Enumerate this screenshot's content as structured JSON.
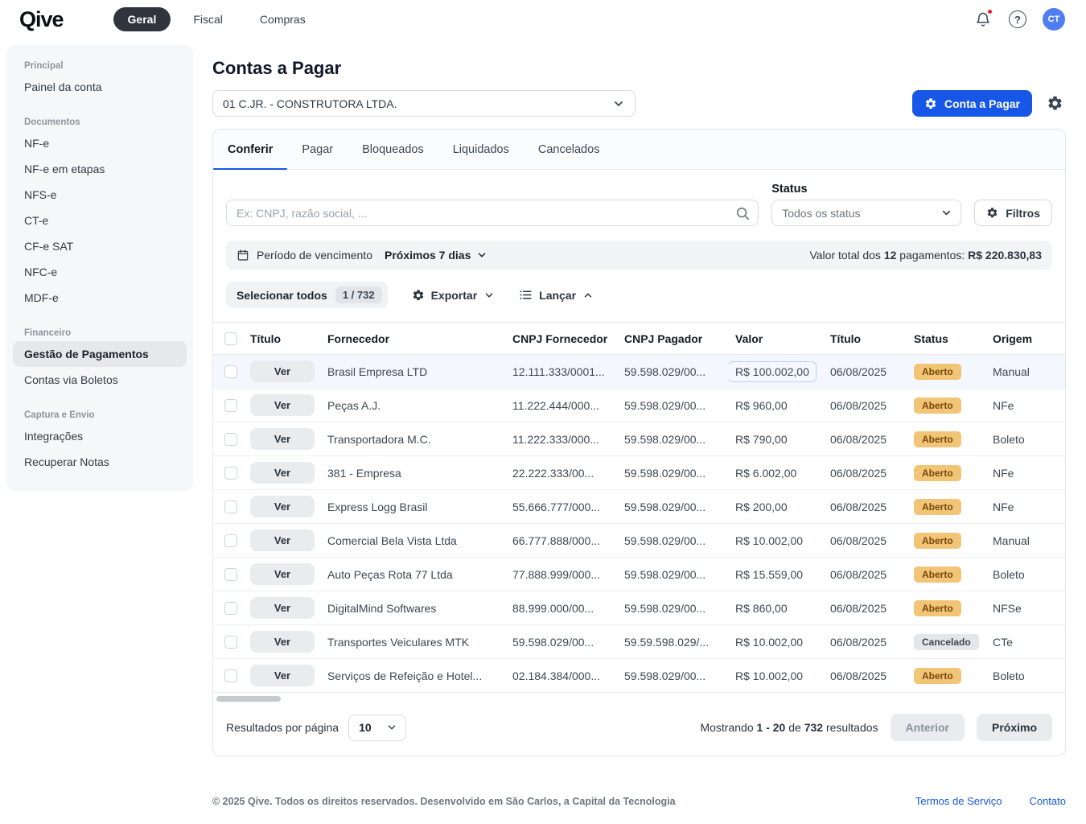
{
  "topbar": {
    "logo": "Qive",
    "nav": [
      {
        "label": "Geral",
        "active": true
      },
      {
        "label": "Fiscal",
        "active": false
      },
      {
        "label": "Compras",
        "active": false
      }
    ],
    "help_glyph": "?",
    "avatar": "CT"
  },
  "sidebar": {
    "sections": [
      {
        "title": "Principal",
        "items": [
          {
            "label": "Painel da conta",
            "active": false
          }
        ]
      },
      {
        "title": "Documentos",
        "items": [
          {
            "label": "NF-e",
            "active": false
          },
          {
            "label": "NF-e em etapas",
            "active": false
          },
          {
            "label": "NFS-e",
            "active": false
          },
          {
            "label": "CT-e",
            "active": false
          },
          {
            "label": "CF-e SAT",
            "active": false
          },
          {
            "label": "NFC-e",
            "active": false
          },
          {
            "label": "MDF-e",
            "active": false
          }
        ]
      },
      {
        "title": "Financeiro",
        "items": [
          {
            "label": "Gestão de Pagamentos",
            "active": true
          },
          {
            "label": "Contas via Boletos",
            "active": false
          }
        ]
      },
      {
        "title": "Captura e Envio",
        "items": [
          {
            "label": "Integrações",
            "active": false
          },
          {
            "label": "Recuperar Notas",
            "active": false
          }
        ]
      }
    ]
  },
  "page": {
    "title": "Contas a Pagar",
    "company_select": "01 C.JR. - CONSTRUTORA LTDA.",
    "primary_button": "Conta a Pagar"
  },
  "tabs": [
    {
      "label": "Conferir",
      "active": true
    },
    {
      "label": "Pagar",
      "active": false
    },
    {
      "label": "Bloqueados",
      "active": false
    },
    {
      "label": "Liquidados",
      "active": false
    },
    {
      "label": "Cancelados",
      "active": false
    }
  ],
  "filters": {
    "search_placeholder": "Ex: CNPJ, razão social, ...",
    "status_label": "Status",
    "status_value": "Todos os status",
    "filters_button": "Filtros",
    "period_label": "Período de vencimento",
    "period_value": "Próximos 7 dias",
    "total_prefix": "Valor total dos",
    "total_count": "12",
    "total_mid": "pagamentos:",
    "total_value": "R$ 220.830,83"
  },
  "actions": {
    "select_all_label": "Selecionar todos",
    "selected_badge": "1 / 732",
    "export_label": "Exportar",
    "launch_label": "Lançar"
  },
  "table": {
    "headers": [
      "Título",
      "Fornecedor",
      "CNPJ Fornecedor",
      "CNPJ Pagador",
      "Valor",
      "Título",
      "Status",
      "Origem"
    ],
    "view_label": "Ver",
    "rows": [
      {
        "fornecedor": "Brasil Empresa LTD",
        "cnpj_fornecedor": "12.111.333/0001...",
        "cnpj_pagador": "59.598.029/00...",
        "valor": "R$ 100.002,00",
        "titulo": "06/08/2025",
        "status": "Aberto",
        "origem": "Manual",
        "selected": true,
        "valor_highlight": true
      },
      {
        "fornecedor": "Peças A.J.",
        "cnpj_fornecedor": "11.222.444/000...",
        "cnpj_pagador": "59.598.029/00...",
        "valor": "R$ 960,00",
        "titulo": "06/08/2025",
        "status": "Aberto",
        "origem": "NFe",
        "selected": false,
        "valor_highlight": false
      },
      {
        "fornecedor": "Transportadora M.C.",
        "cnpj_fornecedor": "11.222.333/000...",
        "cnpj_pagador": "59.598.029/00...",
        "valor": "R$ 790,00",
        "titulo": "06/08/2025",
        "status": "Aberto",
        "origem": "Boleto",
        "selected": false,
        "valor_highlight": false
      },
      {
        "fornecedor": "381 - Empresa",
        "cnpj_fornecedor": "22.222.333/00...",
        "cnpj_pagador": "59.598.029/00...",
        "valor": "R$ 6.002,00",
        "titulo": "06/08/2025",
        "status": "Aberto",
        "origem": "NFe",
        "selected": false,
        "valor_highlight": false
      },
      {
        "fornecedor": "Express Logg Brasil",
        "cnpj_fornecedor": "55.666.777/000...",
        "cnpj_pagador": "59.598.029/00...",
        "valor": "R$ 200,00",
        "titulo": "06/08/2025",
        "status": "Aberto",
        "origem": "NFe",
        "selected": false,
        "valor_highlight": false
      },
      {
        "fornecedor": "Comercial Bela Vista Ltda",
        "cnpj_fornecedor": "66.777.888/000...",
        "cnpj_pagador": "59.598.029/00...",
        "valor": "R$ 10.002,00",
        "titulo": "06/08/2025",
        "status": "Aberto",
        "origem": "Manual",
        "selected": false,
        "valor_highlight": false
      },
      {
        "fornecedor": "Auto Peças Rota 77 Ltda",
        "cnpj_fornecedor": "77.888.999/000...",
        "cnpj_pagador": "59.598.029/00...",
        "valor": "R$ 15.559,00",
        "titulo": "06/08/2025",
        "status": "Aberto",
        "origem": "Boleto",
        "selected": false,
        "valor_highlight": false
      },
      {
        "fornecedor": "DigitalMind Softwares",
        "cnpj_fornecedor": "88.999.000/00...",
        "cnpj_pagador": "59.598.029/00...",
        "valor": "R$ 860,00",
        "titulo": "06/08/2025",
        "status": "Aberto",
        "origem": "NFSe",
        "selected": false,
        "valor_highlight": false
      },
      {
        "fornecedor": "Transportes Veiculares MTK",
        "cnpj_fornecedor": "59.598.029/00...",
        "cnpj_pagador": "59.59.598.029/...",
        "valor": "R$ 10.002,00",
        "titulo": "06/08/2025",
        "status": "Cancelado",
        "origem": "CTe",
        "selected": false,
        "valor_highlight": false
      },
      {
        "fornecedor": "Serviços de Refeição e Hotel...",
        "cnpj_fornecedor": "02.184.384/000...",
        "cnpj_pagador": "59.598.029/00...",
        "valor": "R$ 10.002,00",
        "titulo": "06/08/2025",
        "status": "Aberto",
        "origem": "Boleto",
        "selected": false,
        "valor_highlight": false
      }
    ]
  },
  "pagination": {
    "per_page_label": "Resultados por página",
    "per_page_value": "10",
    "showing_prefix": "Mostrando",
    "showing_range": "1 - 20",
    "showing_of": "de",
    "showing_total": "732",
    "showing_suffix": "resultados",
    "prev_label": "Anterior",
    "next_label": "Próximo"
  },
  "footer": {
    "copyright": "© 2025 Qive. Todos os direitos reservados. Desenvolvido em São Carlos, a Capital da Tecnologia",
    "links": [
      "Termos de Serviço",
      "Contato"
    ]
  },
  "colors": {
    "accent_blue": "#1657e8",
    "nav_active_bg": "#30353d",
    "badge_open_bg": "#f2c476",
    "badge_open_text": "#77480b",
    "badge_cancel_bg": "#e4e6ea",
    "badge_cancel_text": "#3f4753",
    "selected_row_bg": "#f4f8fe",
    "notification_dot": "#e02424"
  }
}
